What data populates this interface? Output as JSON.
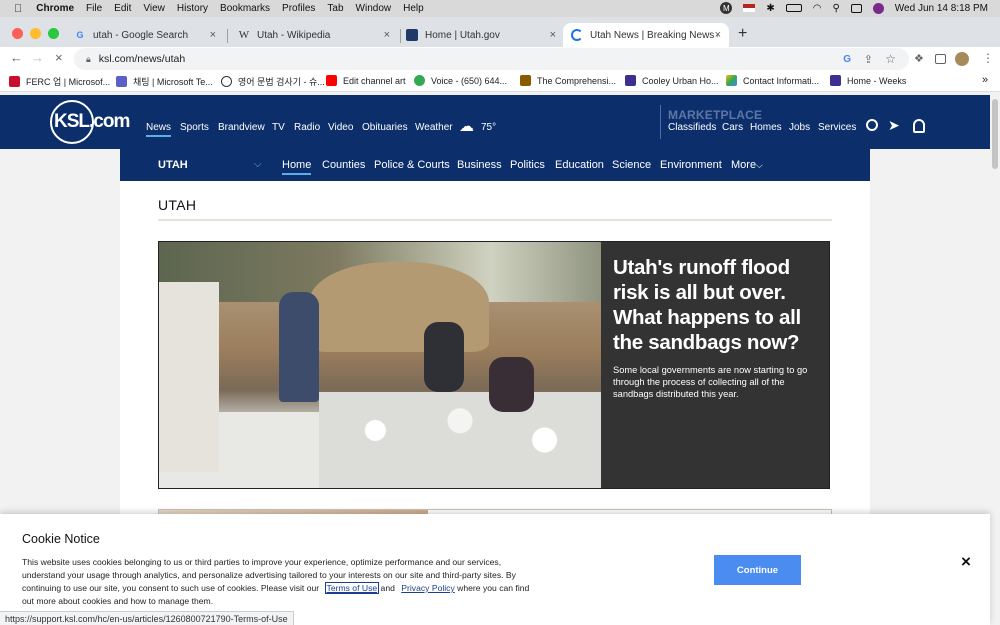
{
  "menubar": {
    "app": "Chrome",
    "items": [
      "File",
      "Edit",
      "View",
      "History",
      "Bookmarks",
      "Profiles",
      "Tab",
      "Window",
      "Help"
    ],
    "datetime": "Wed Jun 14  8:18 PM"
  },
  "tabs": [
    {
      "title": "utah - Google Search",
      "favicon": "google-icon"
    },
    {
      "title": "Utah - Wikipedia",
      "favicon": "wikipedia-icon"
    },
    {
      "title": "Home | Utah.gov",
      "favicon": "utahgov-icon"
    },
    {
      "title": "Utah News | Breaking News & I",
      "favicon": "loading-icon"
    }
  ],
  "address": {
    "url": "ksl.com/news/utah"
  },
  "bookmarks": [
    {
      "label": "FERC 업 | Microsof...",
      "color": "#c8102e"
    },
    {
      "label": "채팅 | Microsoft Te...",
      "color": "#5b5fc7"
    },
    {
      "label": "영어 문법 검사기 - 슈...",
      "color": "#333333"
    },
    {
      "label": "Edit channel art",
      "color": "#ff0000"
    },
    {
      "label": "Voice - (650) 644...",
      "color": "#34a853"
    },
    {
      "label": "The Comprehensi...",
      "color": "#8a5a00"
    },
    {
      "label": "Cooley Urban Ho...",
      "color": "#3b2f8f"
    },
    {
      "label": "Contact Informati...",
      "color": "#fbbc05"
    },
    {
      "label": "Home - Weeks",
      "color": "#3b2f8f"
    }
  ],
  "site": {
    "logo": "KSL.com",
    "nav": [
      "News",
      "Sports",
      "Brandview",
      "TV",
      "Radio",
      "Video",
      "Obituaries",
      "Weather"
    ],
    "temperature": "75°",
    "marketplace_label": "MARKETPLACE",
    "market_nav": [
      "Classifieds",
      "Cars",
      "Homes",
      "Jobs",
      "Services"
    ],
    "colors": {
      "header": "#0c2e6b",
      "accent": "#5ab0e6"
    }
  },
  "subnav": {
    "section": "UTAH",
    "items": [
      "Home",
      "Counties",
      "Police & Courts",
      "Business",
      "Politics",
      "Education",
      "Science",
      "Environment",
      "More"
    ]
  },
  "page": {
    "heading": "UTAH"
  },
  "lead_story": {
    "headline": "Utah's runoff flood risk is all but over. What happens to all the sandbags now?",
    "summary": "Some local governments are now starting to go through the process of collecting all of the sandbags distributed this year."
  },
  "cookie": {
    "title": "Cookie Notice",
    "body_1": "This website uses cookies belonging to us or third parties to improve your experience, optimize performance and our services, understand your usage through analytics, and personalize advertising tailored to your interests on our site and third-party sites. By continuing to use our site, you consent to such use of cookies. Please visit our",
    "terms_link": "Terms of Use",
    "and": "and",
    "privacy_link": "Privacy Policy",
    "body_2": "where you can find out more about cookies and how to manage them.",
    "continue_label": "Continue",
    "close_label": "×"
  },
  "status_url": "https://support.ksl.com/hc/en-us/articles/1260800721790-Terms-of-Use"
}
